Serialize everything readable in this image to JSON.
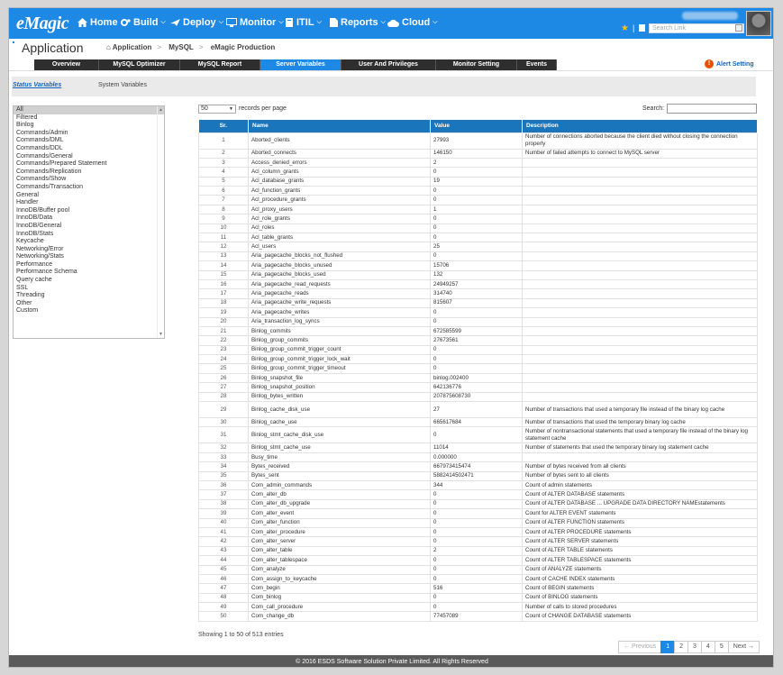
{
  "topbar": {
    "logo": "eMagic",
    "nav": [
      "Home",
      "Build",
      "Deploy",
      "Monitor",
      "ITIL",
      "Reports",
      "Cloud"
    ],
    "quick_link_placeholder": "Search Link"
  },
  "header": {
    "title": "Application",
    "breadcrumb": [
      "Application",
      "MySQL",
      "eMagic Production"
    ]
  },
  "tabs": [
    "Overview",
    "MySQL Optimizer",
    "MySQL Report",
    "Server Variables",
    "User And Privileges",
    "Monitor Setting",
    "Events"
  ],
  "active_tab": "Server Variables",
  "alert_setting": "Alert Setting",
  "subtabs": {
    "status": "Status Variables",
    "system": "System Variables"
  },
  "categories": [
    "All",
    "Filtered",
    "Binlog",
    "Commands/Admin",
    "Commands/DML",
    "Commands/DDL",
    "Commands/General",
    "Commands/Prepared Statement",
    "Commands/Replication",
    "Commands/Show",
    "Commands/Transaction",
    "General",
    "Handler",
    "InnoDB/Buffer pool",
    "InnoDB/Data",
    "InnoDB/General",
    "InnoDB/Stats",
    "Keycache",
    "Networking/Error",
    "Networking/Stats",
    "Performance",
    "Performance Schema",
    "Query cache",
    "SSL",
    "Threading",
    "Other",
    "Custom"
  ],
  "table_controls": {
    "length_value": "50",
    "length_label": "records per page",
    "search_label": "Search:"
  },
  "columns": [
    "Sr.",
    "Name",
    "Value",
    "Description"
  ],
  "rows": [
    [
      "1",
      "Aborted_clients",
      "27993",
      "Number of connections aborted because the client died without closing the connection properly"
    ],
    [
      "2",
      "Aborted_connects",
      "146150",
      "Number of failed attempts to connect to MySQL server"
    ],
    [
      "3",
      "Access_denied_errors",
      "2",
      ""
    ],
    [
      "4",
      "Acl_column_grants",
      "0",
      ""
    ],
    [
      "5",
      "Acl_database_grants",
      "19",
      ""
    ],
    [
      "6",
      "Acl_function_grants",
      "0",
      ""
    ],
    [
      "7",
      "Acl_procedure_grants",
      "0",
      ""
    ],
    [
      "8",
      "Acl_proxy_users",
      "1",
      ""
    ],
    [
      "9",
      "Acl_role_grants",
      "0",
      ""
    ],
    [
      "10",
      "Acl_roles",
      "0",
      ""
    ],
    [
      "11",
      "Acl_table_grants",
      "0",
      ""
    ],
    [
      "12",
      "Acl_users",
      "25",
      ""
    ],
    [
      "13",
      "Aria_pagecache_blocks_not_flushed",
      "0",
      ""
    ],
    [
      "14",
      "Aria_pagecache_blocks_unused",
      "15706",
      ""
    ],
    [
      "15",
      "Aria_pagecache_blocks_used",
      "132",
      ""
    ],
    [
      "16",
      "Aria_pagecache_read_requests",
      "24949257",
      ""
    ],
    [
      "17",
      "Aria_pagecache_reads",
      "314740",
      ""
    ],
    [
      "18",
      "Aria_pagecache_write_requests",
      "815607",
      ""
    ],
    [
      "19",
      "Aria_pagecache_writes",
      "0",
      ""
    ],
    [
      "20",
      "Aria_transaction_log_syncs",
      "0",
      ""
    ],
    [
      "21",
      "Binlog_commits",
      "672585599",
      ""
    ],
    [
      "22",
      "Binlog_group_commits",
      "27673561",
      ""
    ],
    [
      "23",
      "Binlog_group_commit_trigger_count",
      "0",
      ""
    ],
    [
      "24",
      "Binlog_group_commit_trigger_lock_wait",
      "0",
      ""
    ],
    [
      "25",
      "Binlog_group_commit_trigger_timeout",
      "0",
      ""
    ],
    [
      "26",
      "Binlog_snapshot_file",
      "binlog.002400",
      ""
    ],
    [
      "27",
      "Binlog_snapshot_position",
      "642136776",
      ""
    ],
    [
      "28",
      "Binlog_bytes_written",
      "207875608730",
      ""
    ],
    [
      "29",
      "Binlog_cache_disk_use",
      "27",
      "Number of transactions that used a temporary file instead of the binary log cache"
    ],
    [
      "30",
      "Binlog_cache_use",
      "665617684",
      "Number of transactions that used the temporary binary log cache"
    ],
    [
      "31",
      "Binlog_stmt_cache_disk_use",
      "0",
      "Number of nontransactional statements that used a temporary file instead of the binary log statement cache"
    ],
    [
      "32",
      "Binlog_stmt_cache_use",
      "11014",
      "Number of statements that used the temporary binary log statement cache"
    ],
    [
      "33",
      "Busy_time",
      "0.000000",
      ""
    ],
    [
      "34",
      "Bytes_received",
      "667973415474",
      "Number of bytes received from all clients"
    ],
    [
      "35",
      "Bytes_sent",
      "5882414502471",
      "Number of bytes sent to all clients"
    ],
    [
      "36",
      "Com_admin_commands",
      "344",
      "Count of admin statements"
    ],
    [
      "37",
      "Com_alter_db",
      "0",
      "Count of ALTER DATABASE statements"
    ],
    [
      "38",
      "Com_alter_db_upgrade",
      "0",
      "Count of ALTER DATABASE ... UPGRADE DATA DIRECTORY NAMEstatements"
    ],
    [
      "39",
      "Com_alter_event",
      "0",
      "Count for ALTER EVENT statements"
    ],
    [
      "40",
      "Com_alter_function",
      "0",
      "Count of ALTER FUNCTION statements"
    ],
    [
      "41",
      "Com_alter_procedure",
      "0",
      "Count of ALTER PROCEDURE statements"
    ],
    [
      "42",
      "Com_alter_server",
      "0",
      "Count of ALTER SERVER statements"
    ],
    [
      "43",
      "Com_alter_table",
      "2",
      "Count of ALTER TABLE statements"
    ],
    [
      "44",
      "Com_alter_tablespace",
      "0",
      "Count of ALTER TABLESPACE statements"
    ],
    [
      "45",
      "Com_analyze",
      "0",
      "Count of ANALYZE statements"
    ],
    [
      "46",
      "Com_assign_to_keycache",
      "0",
      "Count of CACHE INDEX statements"
    ],
    [
      "47",
      "Com_begin",
      "516",
      "Count of BEGIN statements"
    ],
    [
      "48",
      "Com_binlog",
      "0",
      "Count of BINLOG statements"
    ],
    [
      "49",
      "Com_call_procedure",
      "0",
      "Number of calls to stored procedures"
    ],
    [
      "50",
      "Com_change_db",
      "77457089",
      "Count of CHANGE DATABASE statements"
    ]
  ],
  "info": "Showing 1 to 50 of 513 entries",
  "pagination": [
    "← Previous",
    "1",
    "2",
    "3",
    "4",
    "5",
    "Next →"
  ],
  "footer": "© 2016 ESDS Software Solution Private Limited. All Rights Reserved",
  "colors": {
    "primary": "#1e88e5",
    "tab_dark": "#2e2e2e",
    "table_header": "#1b75bb",
    "footer": "#5a5a5a"
  }
}
